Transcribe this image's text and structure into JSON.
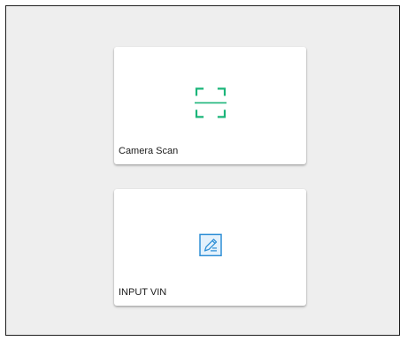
{
  "colors": {
    "scan_accent": "#1bb57a",
    "vin_accent": "#2f8fd6",
    "background": "#eeeeee",
    "card": "#ffffff"
  },
  "options": [
    {
      "label": "Camera Scan",
      "icon": "scan-frame-icon"
    },
    {
      "label": "INPUT VIN",
      "icon": "edit-document-icon"
    }
  ]
}
